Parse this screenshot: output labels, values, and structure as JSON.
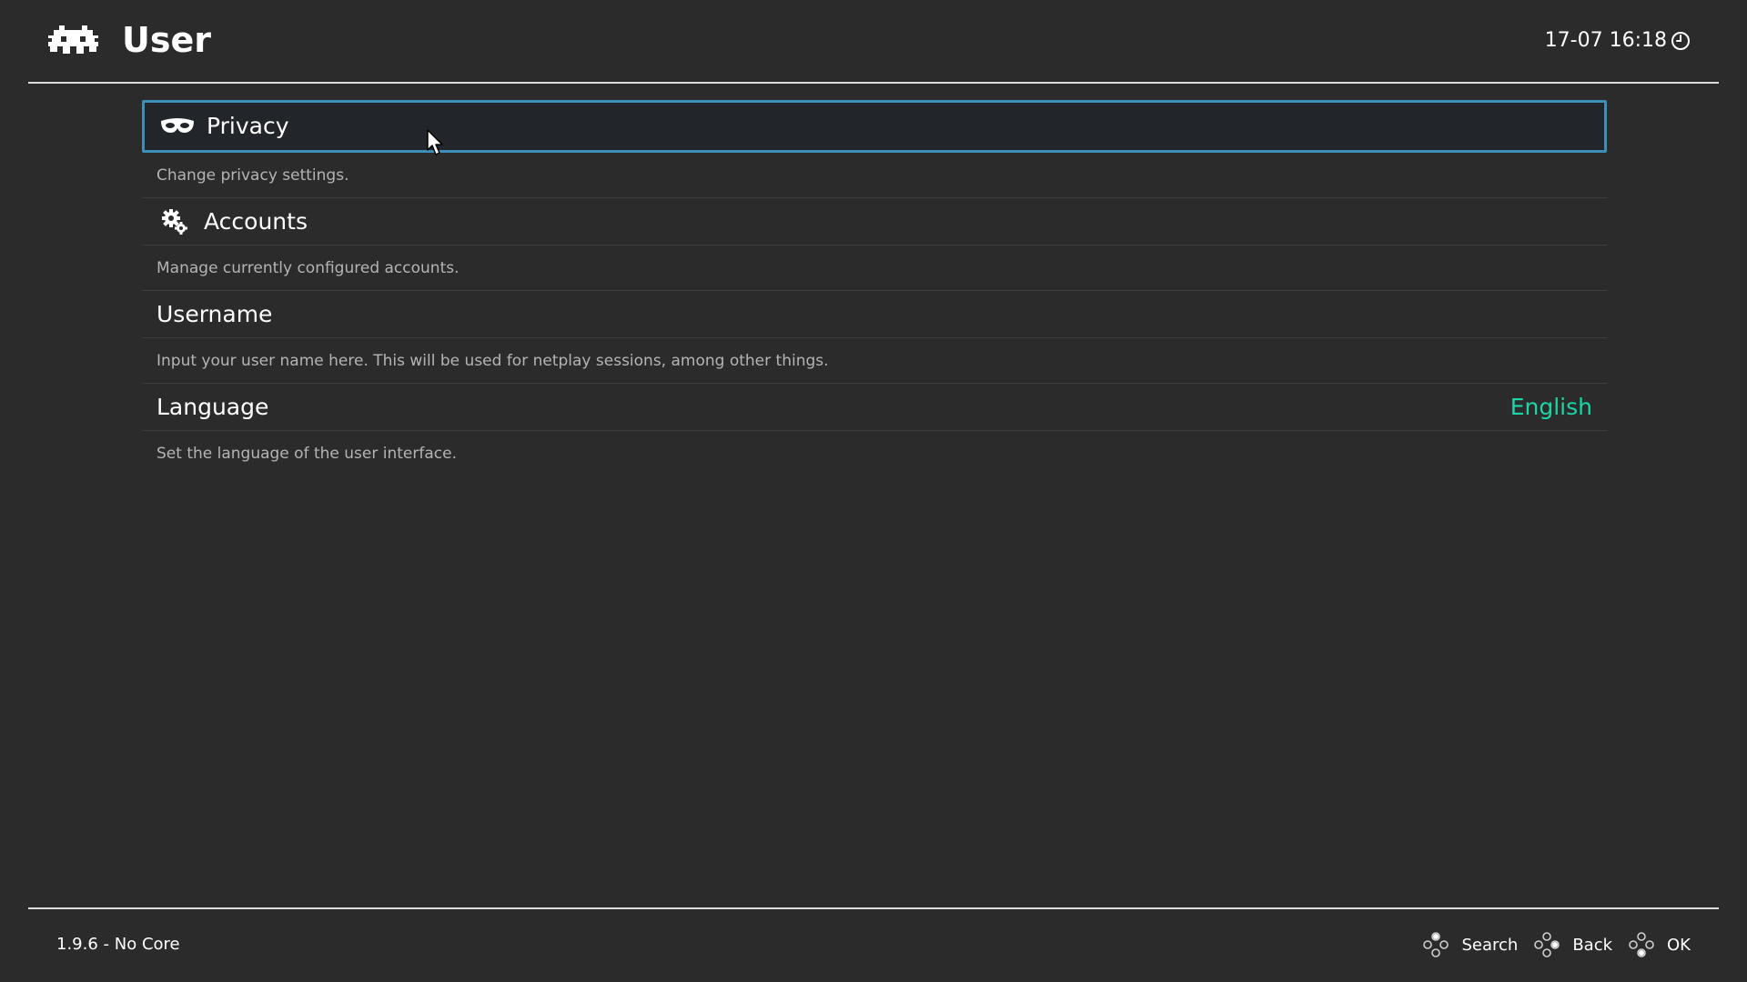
{
  "header": {
    "title": "User",
    "clock": "17-07 16:18",
    "logo_icon": "retroarch-invader-icon",
    "clock_icon": "clock-icon"
  },
  "menu": {
    "items": [
      {
        "label": "Privacy",
        "description": "Change privacy settings.",
        "icon": "mask-icon",
        "selected": true
      },
      {
        "label": "Accounts",
        "description": "Manage currently configured accounts.",
        "icon": "gears-icon",
        "selected": false
      },
      {
        "label": "Username",
        "description": "Input your user name here. This will be used for netplay sessions, among other things.",
        "icon": null,
        "selected": false
      },
      {
        "label": "Language",
        "value": "English",
        "description": "Set the language of the user interface.",
        "icon": null,
        "selected": false
      }
    ]
  },
  "footer": {
    "version": "1.9.6 - No Core",
    "actions": [
      {
        "label": "Search",
        "icon": "gamepad-button-icon"
      },
      {
        "label": "Back",
        "icon": "gamepad-button-icon"
      },
      {
        "label": "OK",
        "icon": "gamepad-button-icon"
      }
    ]
  },
  "colors": {
    "background": "#2b2b2b",
    "selection_border": "#3d8fb7",
    "value_accent": "#19d6a4",
    "description_text": "#b4b4b4"
  }
}
